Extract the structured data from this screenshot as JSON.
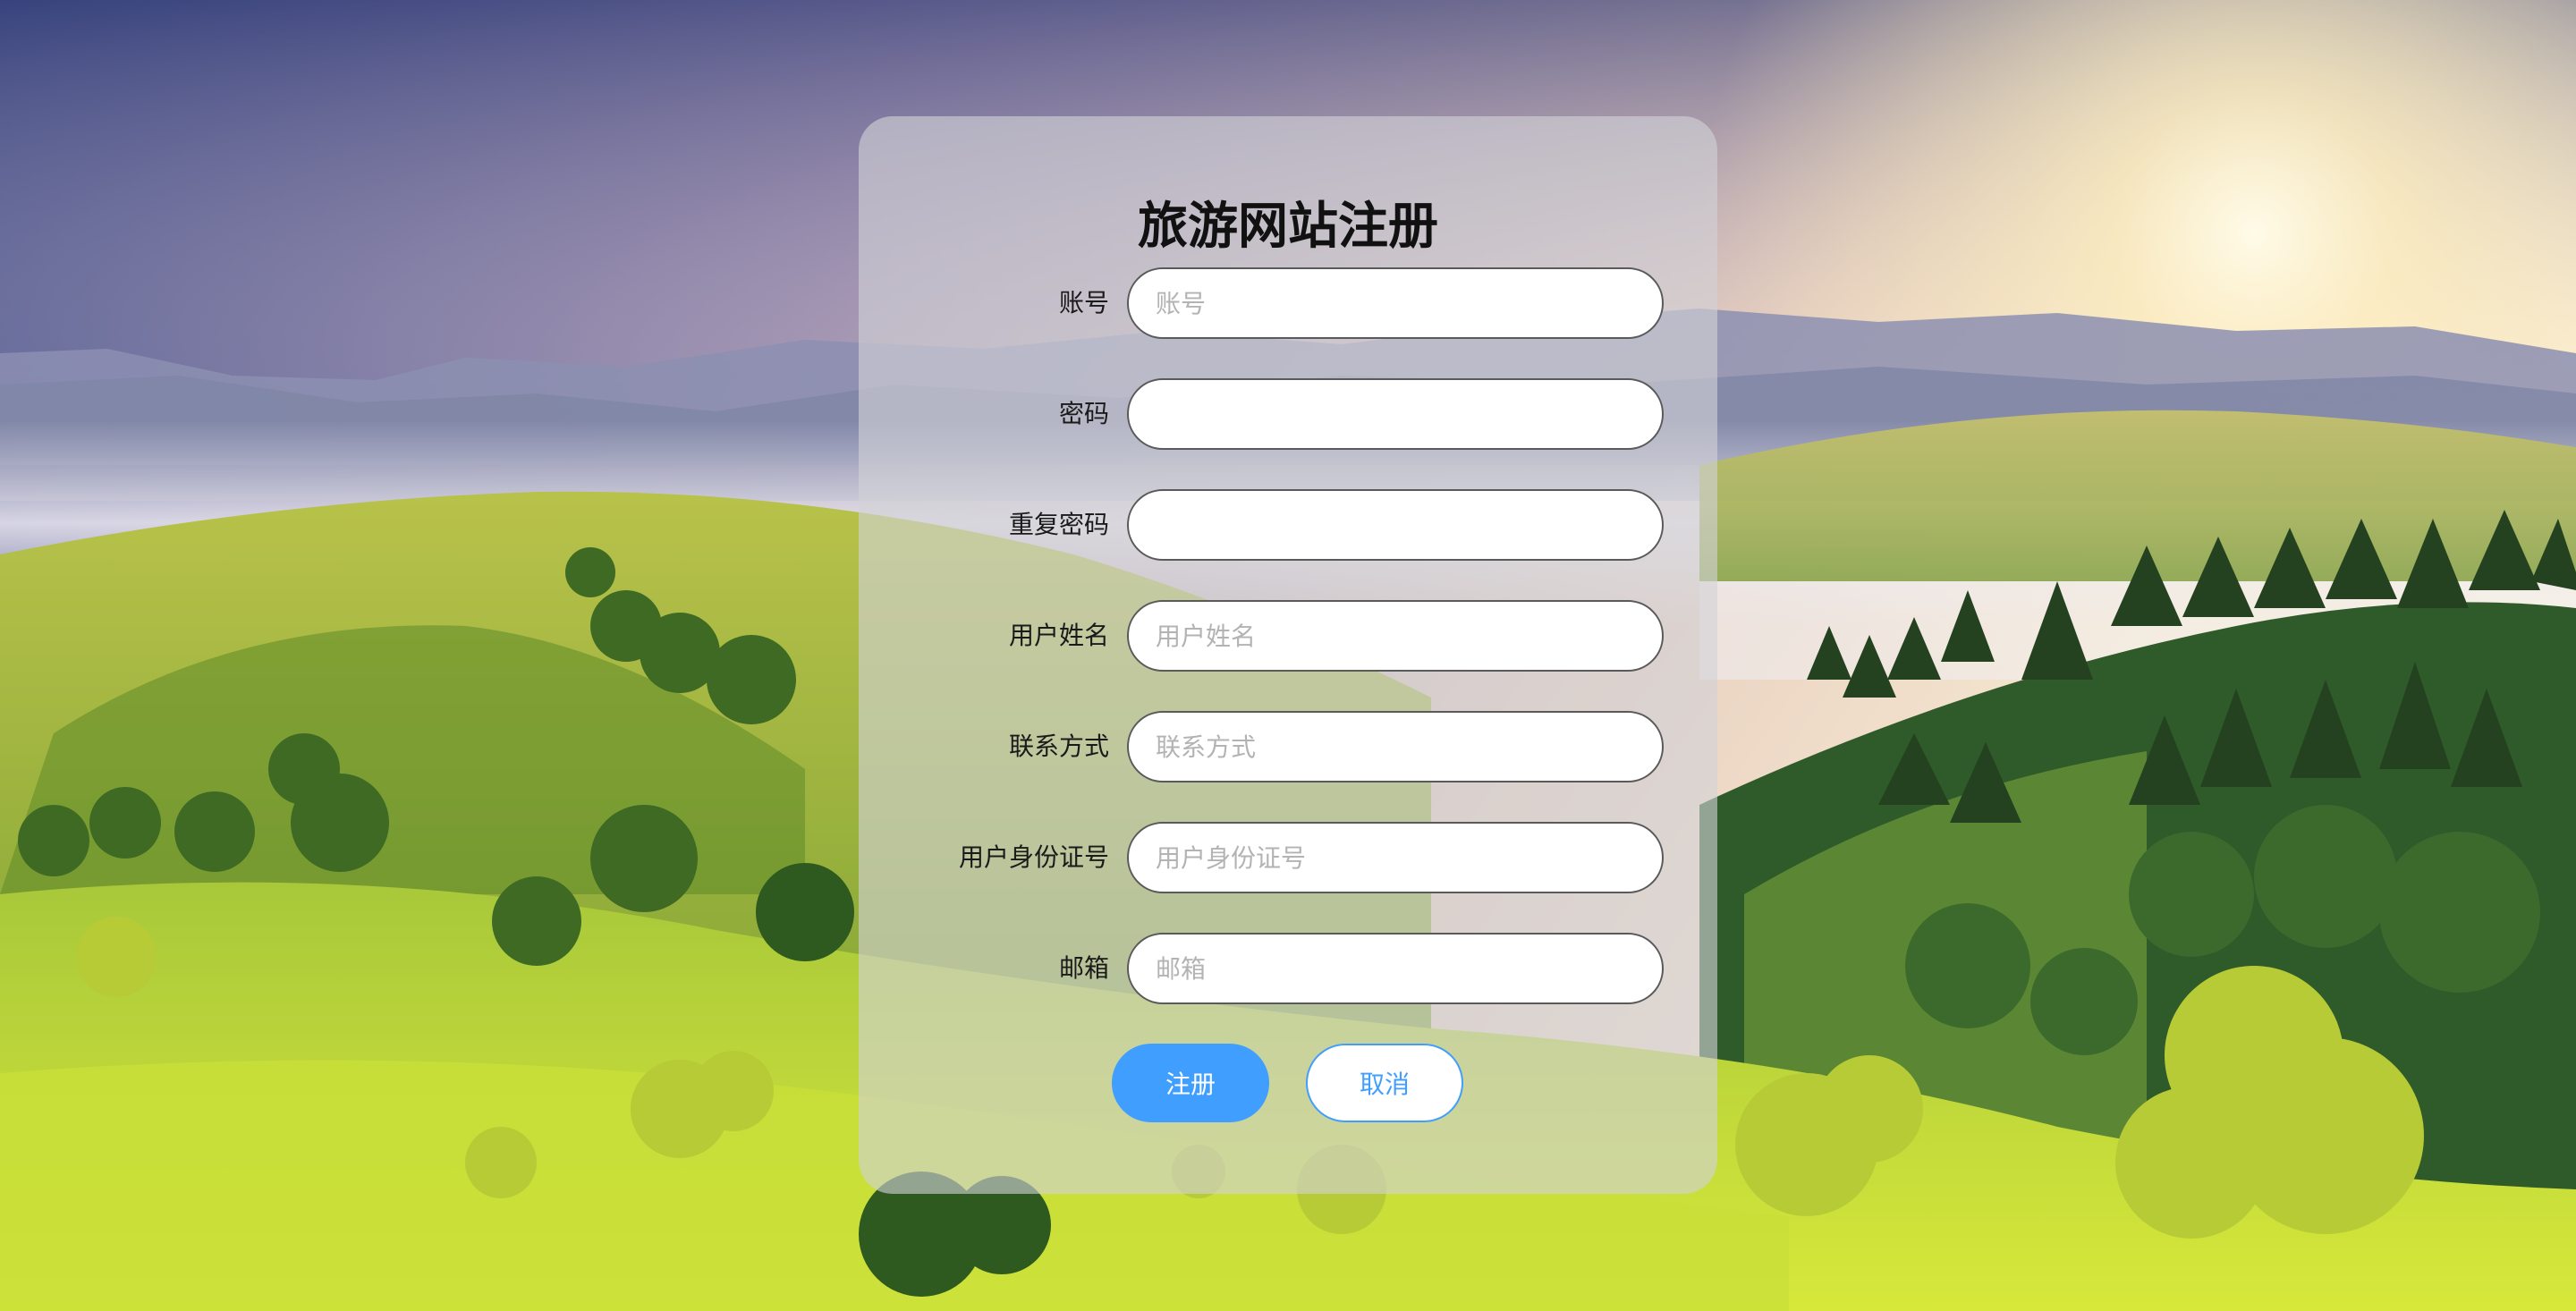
{
  "form": {
    "title": "旅游网站注册",
    "fields": [
      {
        "label": "账号",
        "placeholder": "账号",
        "value": ""
      },
      {
        "label": "密码",
        "placeholder": "",
        "value": ""
      },
      {
        "label": "重复密码",
        "placeholder": "",
        "value": ""
      },
      {
        "label": "用户姓名",
        "placeholder": "用户姓名",
        "value": ""
      },
      {
        "label": "联系方式",
        "placeholder": "联系方式",
        "value": ""
      },
      {
        "label": "用户身份证号",
        "placeholder": "用户身份证号",
        "value": ""
      },
      {
        "label": "邮箱",
        "placeholder": "邮箱",
        "value": ""
      }
    ],
    "register_label": "注册",
    "cancel_label": "取消"
  },
  "colors": {
    "accent": "#409eff",
    "panel": "#d2d2d6",
    "input_border": "#5a5a5a"
  }
}
